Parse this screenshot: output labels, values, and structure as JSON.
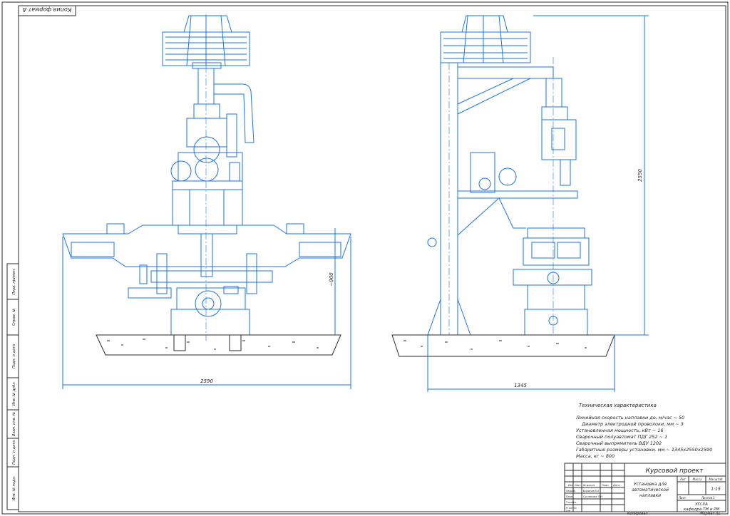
{
  "stamp_top": "Копия формат А",
  "dimensions": {
    "front_width": "2590",
    "front_height": "~900",
    "side_width": "1345",
    "side_height": "2550"
  },
  "tech": {
    "heading": "Техническая характеристика",
    "lines": [
      "Линейная скорость наплавки до, м/час ~ 50",
      "Диаметр электродной проволоки, мм ~ 3",
      "Установленная мощность, кВт ~ 16",
      "Сварочный полуавтомат ПДГ 252 ~ 1",
      "Сварочный выпрямитель ВДУ 1202",
      "Габаритные размеры установки, мм ~ 1345х2550х2590",
      "Масса, кг ~ 800"
    ]
  },
  "titleblock": {
    "project": "Курсовой проект",
    "name": [
      "Установка для",
      "автоматической",
      "наплавки"
    ],
    "col_heads": [
      "Лит",
      "Масса",
      "Масштаб"
    ],
    "scale": "1:15",
    "sheet": "Лист",
    "sheets": "Листов 1",
    "org": [
      "УГСХА",
      "кафедра ТМ и РМ"
    ],
    "rows_labels": [
      "Изм",
      "Лист",
      "№ докум.",
      "Подп.",
      "Дата"
    ],
    "role_labels": [
      "Разраб.",
      "Пров.",
      "Т.контр.",
      "",
      "Н.контр.",
      "Утв."
    ],
    "people": [
      "Борисов В.А",
      "Сусликова Л.Н"
    ],
    "bottom_left": "Копировал",
    "bottom_right": "Формат А1"
  },
  "side_strip": [
    "Перв. примен.",
    "Справ. №",
    "Подп. и дата",
    "Инв. № дубл.",
    "Взам. инв. №",
    "Подп. и дата",
    "Инв. № подл."
  ]
}
